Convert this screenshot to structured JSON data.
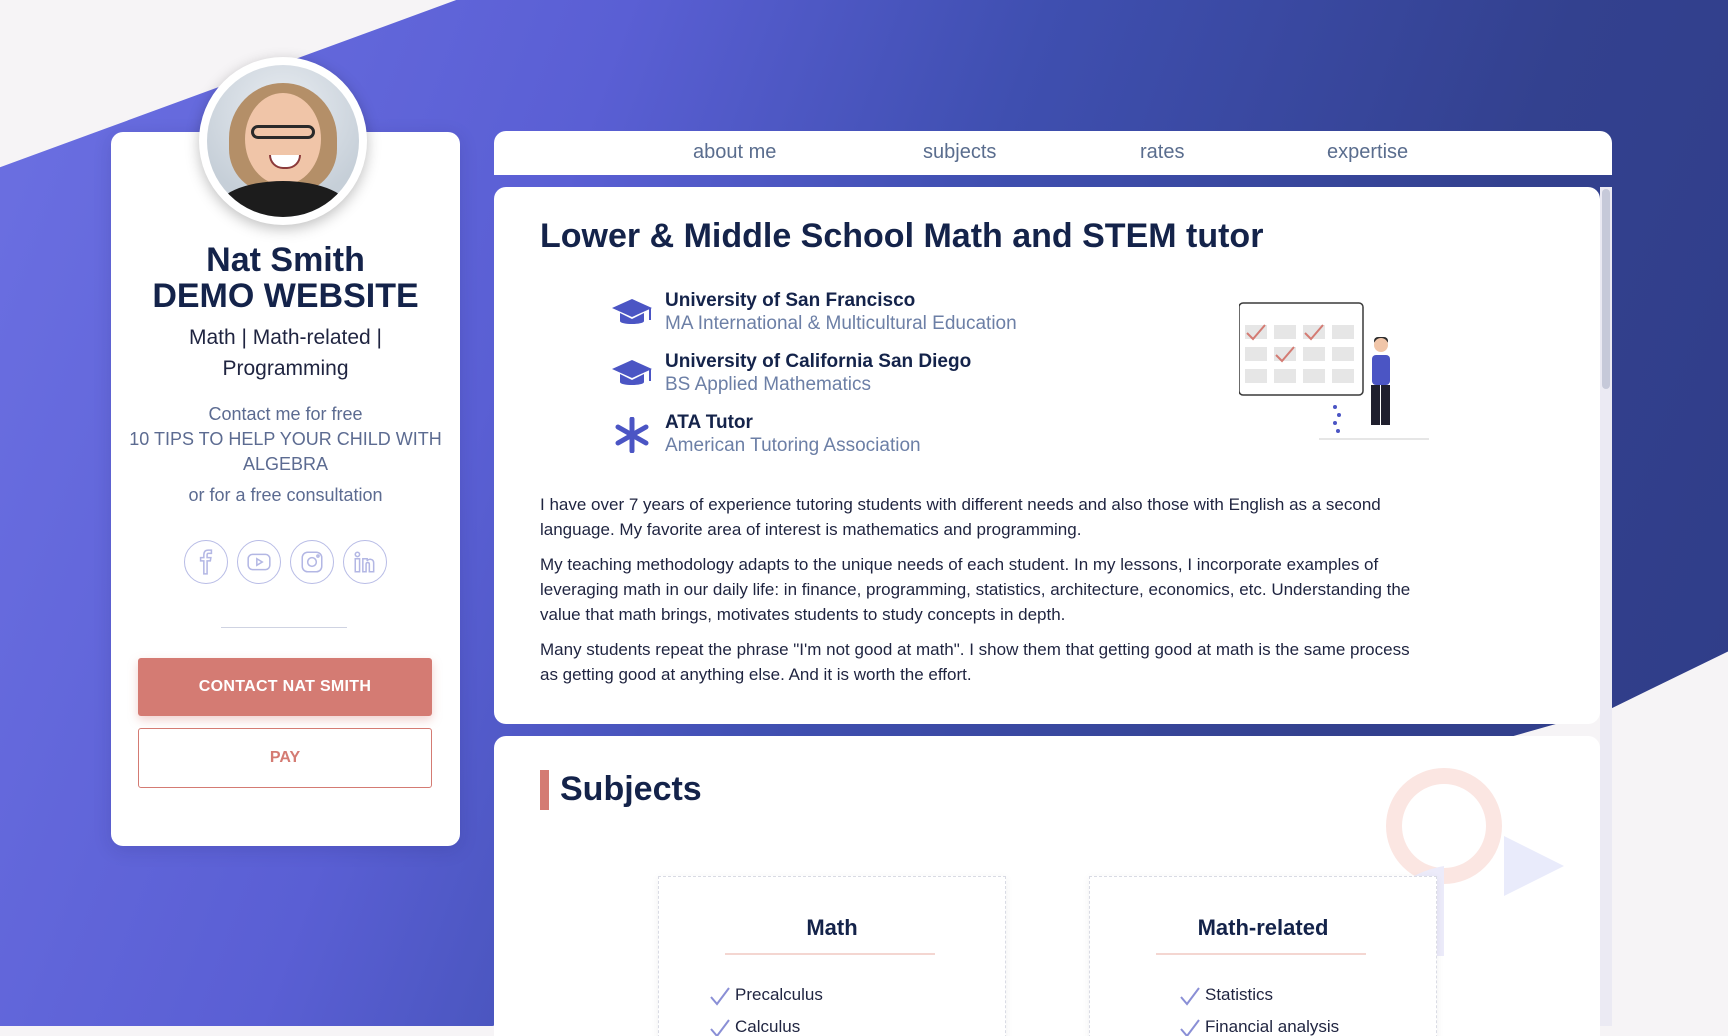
{
  "profile": {
    "name": "Nat Smith",
    "site": "DEMO WEBSITE",
    "tagline": "Math | Math-related | Programming",
    "contact_line1": "Contact me for free",
    "contact_line2": "10 TIPS TO HELP YOUR CHILD WITH ALGEBRA",
    "contact_line3": "or for a free consultation",
    "socials": [
      "facebook-icon",
      "youtube-icon",
      "instagram-icon",
      "linkedin-icon"
    ],
    "contact_button": "CONTACT NAT SMITH",
    "pay_button": "PAY"
  },
  "nav": {
    "items": [
      "about me",
      "subjects",
      "rates",
      "expertise"
    ]
  },
  "about": {
    "heading": "Lower & Middle School Math and STEM tutor",
    "education": [
      {
        "title": "University of San Francisco",
        "subtitle": "MA International & Multicultural Education",
        "icon": "graduation-cap-icon"
      },
      {
        "title": "University of California San Diego",
        "subtitle": "BS Applied Mathematics",
        "icon": "graduation-cap-icon"
      },
      {
        "title": "ATA Tutor",
        "subtitle": "American Tutoring Association",
        "icon": "asterisk-icon"
      }
    ],
    "bio": [
      "I have over 7 years of experience tutoring students with different needs and also those with English as a second language. My favorite area of interest is mathematics and programming.",
      "My teaching methodology adapts to the unique needs of each student. In my lessons, I incorporate examples of leveraging math in our daily life: in finance, programming, statistics, architecture, economics, etc. Understanding the value that math brings, motivates students to study concepts in depth.",
      "Many students repeat the phrase \"I'm not good at math\". I show them that getting good at math is the same process as getting good at anything else. And it is worth the effort."
    ]
  },
  "subjects": {
    "heading": "Subjects",
    "cards": [
      {
        "title": "Math",
        "items": [
          "Precalculus",
          "Calculus"
        ]
      },
      {
        "title": "Math-related",
        "items": [
          "Statistics",
          "Financial analysis"
        ]
      }
    ]
  },
  "colors": {
    "accent": "#d47b73",
    "primary": "#14234a",
    "muted": "#5c6b91",
    "brand_blue": "#4b55c4"
  }
}
